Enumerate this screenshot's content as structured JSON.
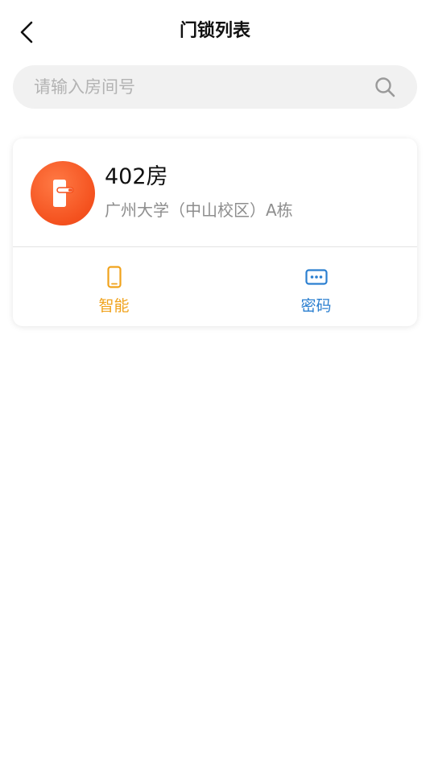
{
  "header": {
    "title": "门锁列表",
    "back_icon": "chevron-left-icon"
  },
  "search": {
    "placeholder": "请输入房间号",
    "value": "",
    "icon": "search-icon"
  },
  "locks": [
    {
      "room": "402房",
      "address": "广州大学（中山校区）A栋",
      "avatar_icon": "door-lock-icon",
      "avatar_color": "#f4511e",
      "actions": [
        {
          "label": "智能",
          "icon": "smartphone-icon",
          "color": "#f0a21b"
        },
        {
          "label": "密码",
          "icon": "password-dots-icon",
          "color": "#2b7fd0"
        }
      ]
    }
  ]
}
